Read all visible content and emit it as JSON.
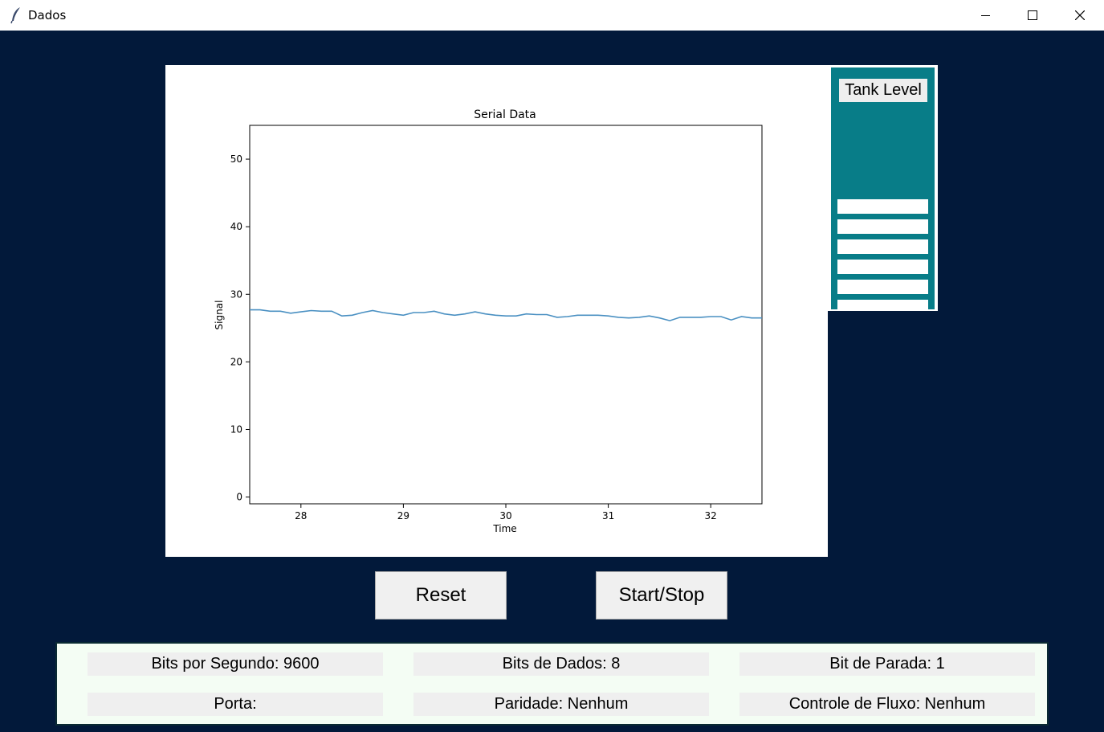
{
  "window": {
    "title": "Dados",
    "icon": "feather-icon"
  },
  "controls": {
    "minimize": "minimize-icon",
    "maximize": "maximize-icon",
    "close": "close-icon"
  },
  "tank": {
    "label": "Tank Level",
    "bars_filled": 6,
    "color": "#087d88"
  },
  "buttons": {
    "reset": "Reset",
    "start_stop": "Start/Stop"
  },
  "info": {
    "baud": "Bits por Segundo: 9600",
    "data_bits": "Bits de Dados: 8",
    "stop_bit": "Bit de Parada: 1",
    "port": "Porta:",
    "parity": "Paridade: Nenhum",
    "flow": "Controle de Fluxo: Nenhum"
  },
  "chart_data": {
    "type": "line",
    "title": "Serial Data",
    "xlabel": "Time",
    "ylabel": "Signal",
    "xlim": [
      27.5,
      32.5
    ],
    "ylim": [
      -1,
      55
    ],
    "xticks": [
      28,
      29,
      30,
      31,
      32
    ],
    "yticks": [
      0,
      10,
      20,
      30,
      40,
      50
    ],
    "grid": false,
    "line_color": "#4a90c2",
    "x": [
      27.5,
      27.6,
      27.7,
      27.8,
      27.9,
      28.0,
      28.1,
      28.2,
      28.3,
      28.4,
      28.5,
      28.6,
      28.7,
      28.8,
      28.9,
      29.0,
      29.1,
      29.2,
      29.3,
      29.4,
      29.5,
      29.6,
      29.7,
      29.8,
      29.9,
      30.0,
      30.1,
      30.2,
      30.3,
      30.4,
      30.5,
      30.6,
      30.7,
      30.8,
      30.9,
      31.0,
      31.1,
      31.2,
      31.3,
      31.4,
      31.5,
      31.6,
      31.7,
      31.8,
      31.9,
      32.0,
      32.1,
      32.2,
      32.3,
      32.4,
      32.5
    ],
    "y": [
      27.7,
      27.7,
      27.5,
      27.5,
      27.2,
      27.4,
      27.6,
      27.5,
      27.5,
      26.8,
      26.9,
      27.3,
      27.6,
      27.3,
      27.1,
      26.9,
      27.3,
      27.3,
      27.5,
      27.1,
      26.9,
      27.1,
      27.4,
      27.1,
      26.9,
      26.8,
      26.8,
      27.1,
      27.0,
      27.0,
      26.6,
      26.7,
      26.9,
      26.9,
      26.9,
      26.8,
      26.6,
      26.5,
      26.6,
      26.8,
      26.5,
      26.1,
      26.6,
      26.6,
      26.6,
      26.7,
      26.7,
      26.2,
      26.7,
      26.5,
      26.5
    ]
  }
}
